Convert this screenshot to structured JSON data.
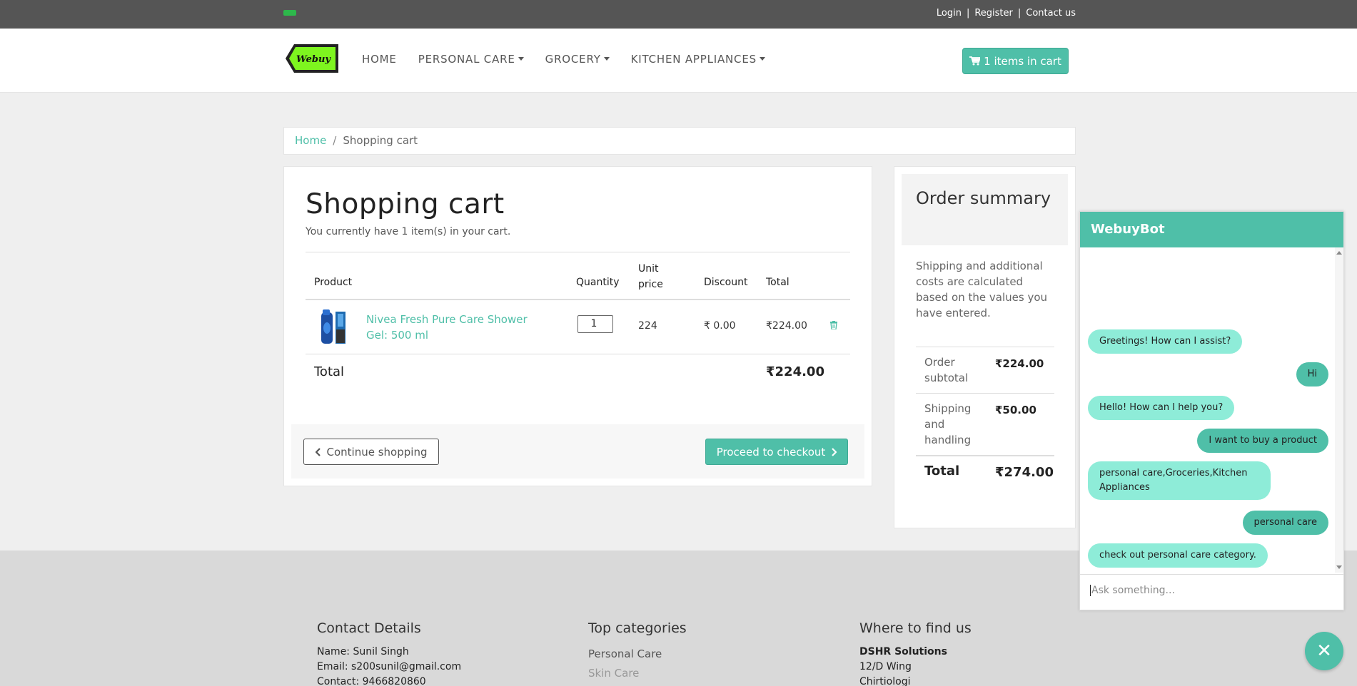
{
  "topbar": {
    "links": [
      "Login",
      "Register",
      "Contact us"
    ],
    "separator": "|"
  },
  "navbar": {
    "logo_text": "Webuy",
    "menu": [
      "HOME",
      "PERSONAL CARE",
      "GROCERY",
      "KITCHEN APPLIANCES"
    ],
    "cart_button": "1 items in cart"
  },
  "breadcrumb": {
    "home": "Home",
    "separator": "/",
    "current": "Shopping cart"
  },
  "cart": {
    "title": "Shopping cart",
    "subtitle": "You currently have 1 item(s) in your cart.",
    "columns": {
      "product": "Product",
      "quantity": "Quantity",
      "unit_price": "Unit price",
      "discount": "Discount",
      "total": "Total"
    },
    "items": [
      {
        "name": "Nivea Fresh Pure Care Shower Gel: 500 ml",
        "quantity": "1",
        "unit_price": "224",
        "discount": "₹ 0.00",
        "total": "₹224.00"
      }
    ],
    "total_label": "Total",
    "total_value": "₹224.00",
    "continue_button": "Continue shopping",
    "checkout_button": "Proceed to checkout"
  },
  "summary": {
    "title": "Order summary",
    "text": "Shipping and additional costs are calculated based on the values you have entered.",
    "rows": [
      {
        "label": "Order subtotal",
        "value": "₹224.00"
      },
      {
        "label": "Shipping and handling",
        "value": "₹50.00"
      }
    ],
    "total_label": "Total",
    "total_value": "₹274.00"
  },
  "footer": {
    "contact": {
      "title": "Contact Details",
      "name": "Name: Sunil Singh",
      "email": "Email: s200sunil@gmail.com",
      "contact": "Contact: 9466820860"
    },
    "categories": {
      "title": "Top categories",
      "items": [
        "Personal Care",
        "Skin Care"
      ]
    },
    "location": {
      "title": "Where to find us",
      "company": "DSHR Solutions",
      "line1": "12/D Wing",
      "line2": "Chirtiologi"
    }
  },
  "chatbot": {
    "title": "WebuyBot",
    "messages": [
      {
        "from": "bot",
        "text": "Greetings! How can I assist?"
      },
      {
        "from": "user",
        "text": "Hi"
      },
      {
        "from": "bot",
        "text": "Hello! How can I help you?"
      },
      {
        "from": "user",
        "text": "I want to buy a product"
      },
      {
        "from": "bot",
        "text": "personal care,Groceries,Kitchen Appliances"
      },
      {
        "from": "user",
        "text": "personal care"
      },
      {
        "from": "bot",
        "text": "check out personal care category."
      }
    ],
    "input_placeholder": "Ask something...",
    "close_icon": "close-icon"
  },
  "colors": {
    "accent": "#4fbfa8",
    "bot_bubble": "#8eecd8",
    "topbar": "#555555"
  }
}
